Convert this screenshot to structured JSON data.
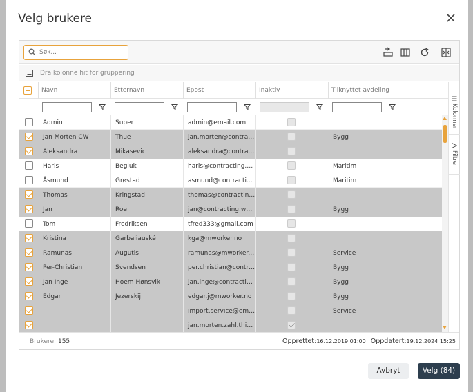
{
  "dialog": {
    "title": "Velg brukere",
    "search_placeholder": "Søk...",
    "group_hint": "Dra kolonne hit for gruppering",
    "columns": [
      "Navn",
      "Etternavn",
      "Epost",
      "Inaktiv",
      "Tilknyttet avdeling"
    ],
    "side_tabs": [
      "Kolonner",
      "Filtre"
    ],
    "rows": [
      {
        "selected": false,
        "navn": "Admin",
        "etternavn": "Super",
        "epost": "admin@email.com",
        "inaktiv": false,
        "avdeling": ""
      },
      {
        "selected": true,
        "navn": "Jan Morten CW",
        "etternavn": "Thue",
        "epost": "jan.morten@contract...",
        "inaktiv": false,
        "avdeling": "Bygg"
      },
      {
        "selected": true,
        "navn": "Aleksandra",
        "etternavn": "Mikasevic",
        "epost": "aleksandra@contract...",
        "inaktiv": false,
        "avdeling": ""
      },
      {
        "selected": false,
        "navn": "Haris",
        "etternavn": "Begluk",
        "epost": "haris@contracting.w...",
        "inaktiv": false,
        "avdeling": "Maritim"
      },
      {
        "selected": false,
        "navn": "Åsmund",
        "etternavn": "Grøstad",
        "epost": "asmund@contractin...",
        "inaktiv": false,
        "avdeling": "Maritim"
      },
      {
        "selected": true,
        "navn": "Thomas",
        "etternavn": "Kringstad",
        "epost": "thomas@contracting...",
        "inaktiv": false,
        "avdeling": ""
      },
      {
        "selected": true,
        "navn": "Jan",
        "etternavn": "Roe",
        "epost": "jan@contracting.works",
        "inaktiv": false,
        "avdeling": "Bygg"
      },
      {
        "selected": false,
        "navn": "Tom",
        "etternavn": "Fredriksen",
        "epost": "tfred333@gmail.com",
        "inaktiv": false,
        "avdeling": ""
      },
      {
        "selected": true,
        "navn": "Kristina",
        "etternavn": "Garbaliauské",
        "epost": "kga@mworker.no",
        "inaktiv": false,
        "avdeling": ""
      },
      {
        "selected": true,
        "navn": "Ramunas",
        "etternavn": "Augutis",
        "epost": "ramunas@mworker.no",
        "inaktiv": false,
        "avdeling": "Service"
      },
      {
        "selected": true,
        "navn": "Per-Christian",
        "etternavn": "Svendsen",
        "epost": "per.christian@contra...",
        "inaktiv": false,
        "avdeling": "Bygg"
      },
      {
        "selected": true,
        "navn": "Jan Inge",
        "etternavn": "Hoem Hønsvik",
        "epost": "jan.inge@contractin...",
        "inaktiv": false,
        "avdeling": "Bygg"
      },
      {
        "selected": true,
        "navn": "Edgar",
        "etternavn": "Jezerskij",
        "epost": "edgar.j@mworker.no",
        "inaktiv": false,
        "avdeling": "Bygg"
      },
      {
        "selected": true,
        "navn": "",
        "etternavn": "",
        "epost": "import.service@emai...",
        "inaktiv": false,
        "avdeling": "Service"
      },
      {
        "selected": true,
        "navn": "",
        "etternavn": "",
        "epost": "jan.morten.zahl.thiue...",
        "inaktiv": true,
        "avdeling": ""
      }
    ],
    "status": {
      "brukere_label": "Brukere:",
      "brukere_count": "155",
      "opprettet_label": "Opprettet:",
      "opprettet_value": "16.12.2019 01:00",
      "oppdatert_label": "Oppdatert:",
      "oppdatert_value": "19.12.2024 15:25"
    },
    "buttons": {
      "cancel": "Avbryt",
      "ok": "Velg (84)"
    }
  },
  "colors": {
    "accent": "#e8a33c",
    "primary_button": "#2d3e4e",
    "selected_row": "#c8c8c8"
  }
}
